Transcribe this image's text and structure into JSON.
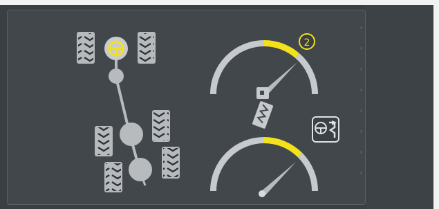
{
  "steering": {
    "mode_label": "2",
    "colors": {
      "accent": "#f3e21b",
      "idle_arc": "#c7cacd",
      "tire": "#b6babd",
      "axle_node": "#b7bbbe"
    },
    "icons": {
      "mode_button": "steering-mode-icon",
      "pedal": "pedal-icon",
      "steering_wheel": "steering-wheel-icon",
      "tire": "tire-tread-icon"
    }
  }
}
